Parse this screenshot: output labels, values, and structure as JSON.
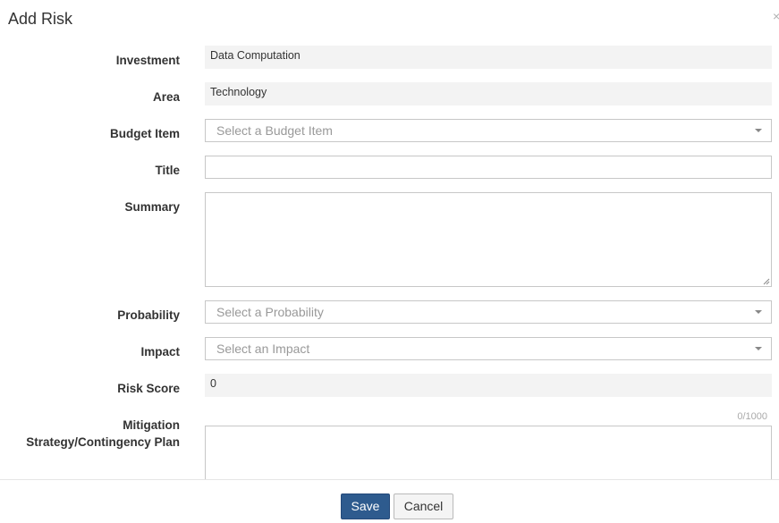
{
  "dialog": {
    "title": "Add Risk",
    "close_glyph": "×"
  },
  "form": {
    "investment": {
      "label": "Investment",
      "value": "Data Computation"
    },
    "area": {
      "label": "Area",
      "value": "Technology"
    },
    "budget_item": {
      "label": "Budget Item",
      "placeholder": "Select a Budget Item"
    },
    "title": {
      "label": "Title",
      "value": ""
    },
    "summary": {
      "label": "Summary",
      "value": ""
    },
    "probability": {
      "label": "Probability",
      "placeholder": "Select a Probability"
    },
    "impact": {
      "label": "Impact",
      "placeholder": "Select an Impact"
    },
    "risk_score": {
      "label": "Risk Score",
      "value": "0"
    },
    "mitigation": {
      "label_line1": "Mitigation",
      "label_line2": "Strategy/Contingency Plan",
      "counter": "0/1000",
      "value": ""
    }
  },
  "footer": {
    "save_label": "Save",
    "cancel_label": "Cancel"
  },
  "colors": {
    "primary_button": "#2e5b8e",
    "readonly_bg": "#f3f3f3",
    "border": "#c7c7c7"
  }
}
